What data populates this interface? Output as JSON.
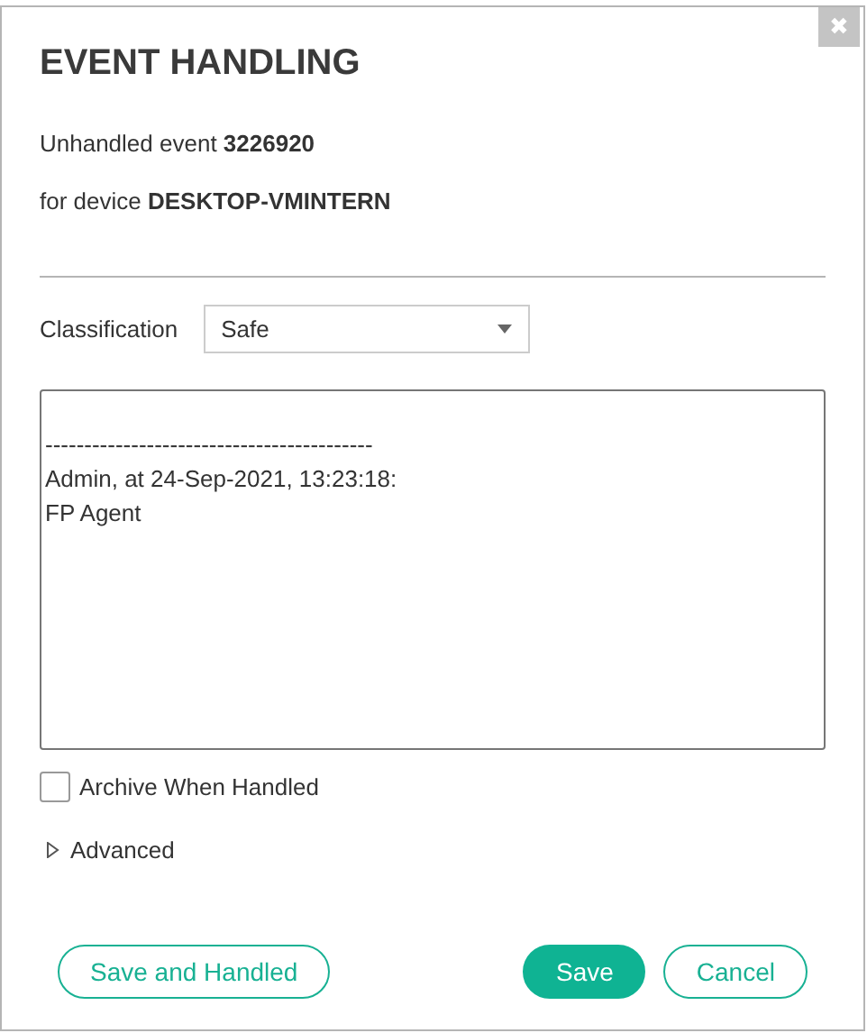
{
  "dialog": {
    "title": "EVENT HANDLING",
    "close_icon": "✖"
  },
  "event_line": "Unhandled event **3226920**",
  "device_line": "for device **DESKTOP-VMINTERN**",
  "classification": {
    "label": "Classification",
    "value": "Safe"
  },
  "notes": {
    "value": "\n------------------------------------------\nAdmin, at 24-Sep-2021, 13:23:18:\nFP Agent"
  },
  "archive": {
    "label": "Archive When Handled",
    "checked": false
  },
  "advanced": {
    "label": "Advanced",
    "expanded": false
  },
  "buttons": [
    {
      "label": "Save and Handled",
      "kind": "outline"
    },
    {
      "kind": "spacer"
    },
    {
      "label": "Save",
      "kind": "primary"
    },
    {
      "label": "Cancel",
      "kind": "outline"
    }
  ]
}
